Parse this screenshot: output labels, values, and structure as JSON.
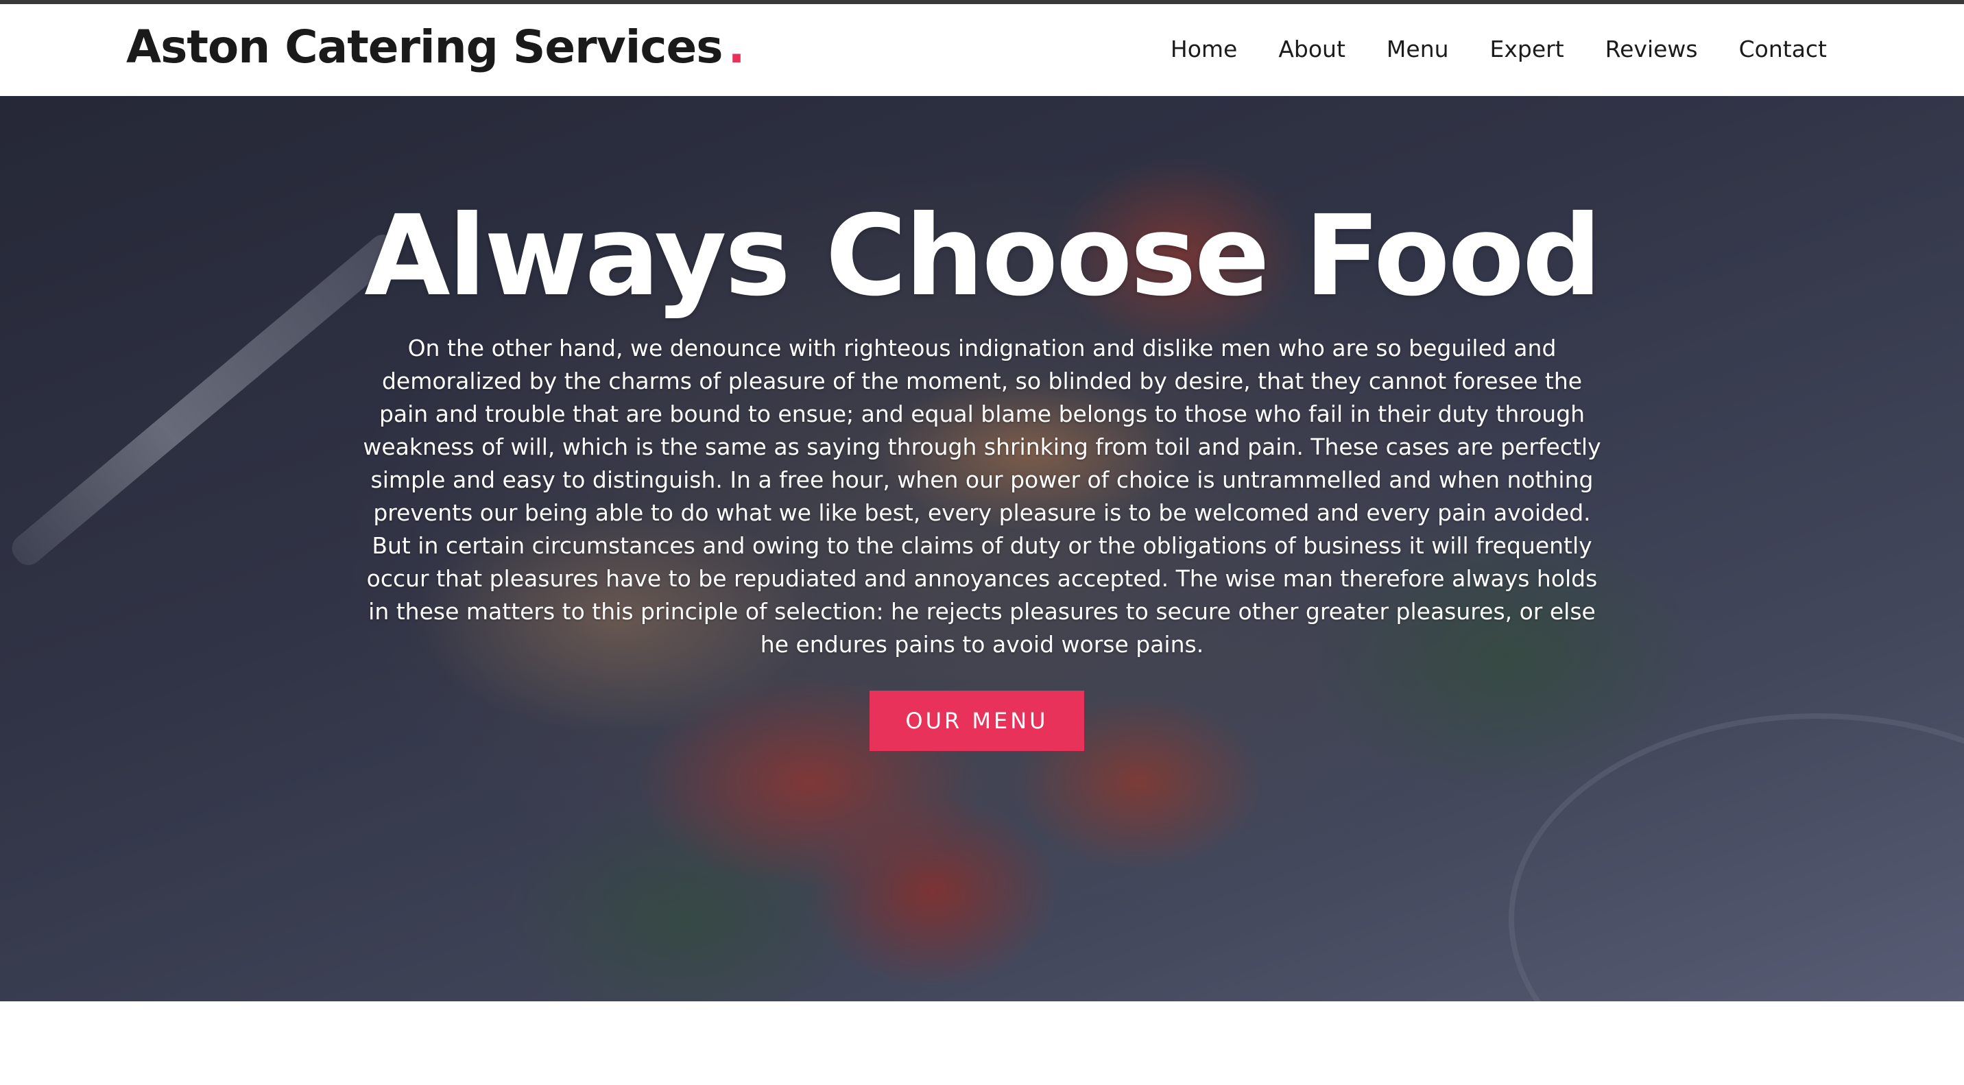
{
  "header": {
    "brand": "Aston Catering Services",
    "brand_dot": ".",
    "nav": [
      "Home",
      "About",
      "Menu",
      "Expert",
      "Reviews",
      "Contact"
    ]
  },
  "hero": {
    "title": "Always Choose Food",
    "body": "On the other hand, we denounce with righteous indignation and dislike men who are so beguiled and demoralized by the charms of pleasure of the moment, so blinded by desire, that they cannot foresee the pain and trouble that are bound to ensue; and equal blame belongs to those who fail in their duty through weakness of will, which is the same as saying through shrinking from toil and pain. These cases are perfectly simple and easy to distinguish. In a free hour, when our power of choice is untrammelled and when nothing prevents our being able to do what we like best, every pleasure is to be welcomed and every pain avoided. But in certain circumstances and owing to the claims of duty or the obligations of business it will frequently occur that pleasures have to be repudiated and annoyances accepted. The wise man therefore always holds in these matters to this principle of selection: he rejects pleasures to secure other greater pleasures, or else he endures pains to avoid worse pains.",
    "cta_label": "OUR MENU"
  },
  "colors": {
    "accent": "#e8325a",
    "text_dark": "#1a1a1a",
    "hero_text": "#ffffff"
  }
}
